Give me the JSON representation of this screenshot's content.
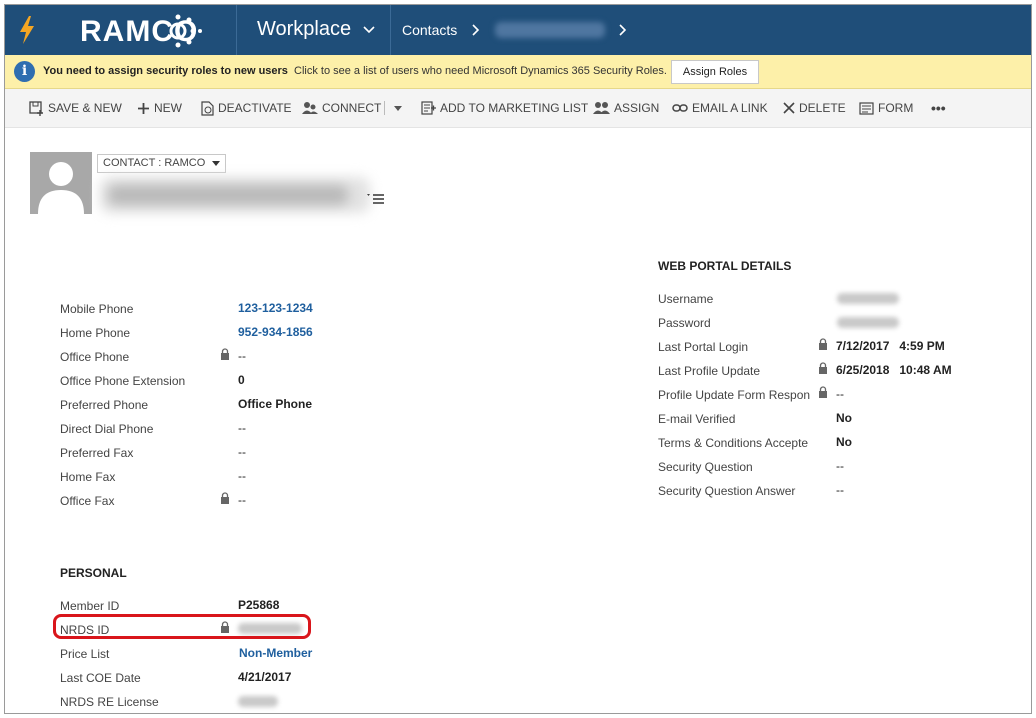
{
  "nav": {
    "logo": "RAMCO",
    "workplace": "Workplace",
    "contacts": "Contacts"
  },
  "notice": {
    "bold_text": "You need to assign security roles to new users",
    "normal_text": "Click to see a list of users who need Microsoft Dynamics 365 Security Roles.",
    "button": "Assign Roles"
  },
  "commands": {
    "save_new": "SAVE & NEW",
    "new": "NEW",
    "deactivate": "DEACTIVATE",
    "connect": "CONNECT",
    "add_marketing": "ADD TO MARKETING LIST",
    "assign": "ASSIGN",
    "email_link": "EMAIL A LINK",
    "delete": "DELETE",
    "form": "FORM",
    "more": "•••"
  },
  "header": {
    "form_selector": "CONTACT : RAMCO"
  },
  "phone": [
    {
      "label": "Mobile Phone",
      "value": "123-123-1234"
    },
    {
      "label": "Home Phone",
      "value": "952-934-1856"
    },
    {
      "label": "Office Phone",
      "value": "--"
    },
    {
      "label": "Office Phone Extension",
      "value": "0"
    },
    {
      "label": "Preferred Phone",
      "value": "Office Phone"
    },
    {
      "label": "Direct Dial Phone",
      "value": "--"
    },
    {
      "label": "Preferred Fax",
      "value": "--"
    },
    {
      "label": "Home Fax",
      "value": "--"
    },
    {
      "label": "Office Fax",
      "value": "--"
    }
  ],
  "personal": {
    "title": "PERSONAL",
    "fields": [
      {
        "label": "Member ID",
        "value": "P25868"
      },
      {
        "label": "NRDS ID",
        "value": ""
      },
      {
        "label": "Price List",
        "value": "Non-Member"
      },
      {
        "label": "Last COE Date",
        "value": "4/21/2017"
      },
      {
        "label": "NRDS RE License",
        "value": ""
      }
    ]
  },
  "portal": {
    "title": "WEB PORTAL DETAILS",
    "fields": [
      {
        "label": "Username",
        "value": ""
      },
      {
        "label": "Password",
        "value": ""
      },
      {
        "label": "Last Portal Login",
        "value": "7/12/2017   4:59 PM"
      },
      {
        "label": "Last Profile Update",
        "value": "6/25/2018   10:48 AM"
      },
      {
        "label": "Profile Update Form Respon",
        "value": "--"
      },
      {
        "label": "E-mail Verified",
        "value": "No"
      },
      {
        "label": "Terms & Conditions Accepte",
        "value": "No"
      },
      {
        "label": "Security Question",
        "value": "--"
      },
      {
        "label": "Security Question Answer",
        "value": "--"
      }
    ]
  },
  "colors": {
    "nav_bg": "#1f4e79",
    "notice_bg": "#fdf0a9",
    "link": "#1f5f9e",
    "highlight": "#d9151b"
  }
}
